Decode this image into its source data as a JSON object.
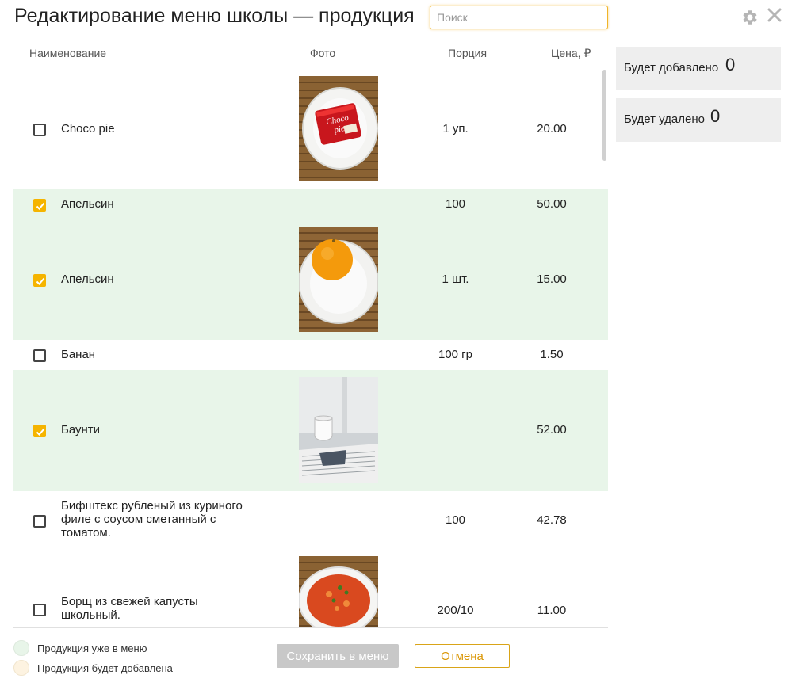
{
  "header": {
    "title": "Редактирование меню школы — продукция",
    "search_placeholder": "Поиск",
    "search_value": ""
  },
  "columns": {
    "name": "Наименование",
    "photo": "Фото",
    "portion": "Порция",
    "price": "Цена, ₽"
  },
  "rows": [
    {
      "name": "Choco pie",
      "portion": "1 уп.",
      "price": "20.00",
      "checked": false,
      "in_menu": false,
      "photo": "choco-pie"
    },
    {
      "name": "Апельсин",
      "portion": "100",
      "price": "50.00",
      "checked": true,
      "in_menu": true,
      "photo": null
    },
    {
      "name": "Апельсин",
      "portion": "1 шт.",
      "price": "15.00",
      "checked": true,
      "in_menu": true,
      "photo": "orange"
    },
    {
      "name": "Банан",
      "portion": "100 гр",
      "price": "1.50",
      "checked": false,
      "in_menu": false,
      "photo": null
    },
    {
      "name": "Баунти",
      "portion": "",
      "price": "52.00",
      "checked": true,
      "in_menu": true,
      "photo": "bounty"
    },
    {
      "name": "Бифштекс рубленый из куриного филе с соусом сметанный с томатом.",
      "portion": "100",
      "price": "42.78",
      "checked": false,
      "in_menu": false,
      "photo": null
    },
    {
      "name": "Борщ из свежей капусты школьный.",
      "portion": "200/10",
      "price": "11.00",
      "checked": false,
      "in_menu": false,
      "photo": "borscht"
    }
  ],
  "summary": {
    "add_label": "Будет добавлено",
    "add_count": "0",
    "remove_label": "Будет удалено",
    "remove_count": "0"
  },
  "legend": {
    "in_menu_label": "Продукция уже в меню",
    "in_menu_color": "#e8f5e9",
    "to_add_label": "Продукция будет добавлена",
    "to_add_color": "#fdf3e1"
  },
  "buttons": {
    "save_label": "Сохранить в меню",
    "cancel_label": "Отмена"
  },
  "colors": {
    "accent": "#f5b400",
    "row_in_menu": "#e8f5e9"
  },
  "icons": {
    "settings": "gear-icon",
    "close": "close-icon",
    "checkbox": "check-icon"
  }
}
